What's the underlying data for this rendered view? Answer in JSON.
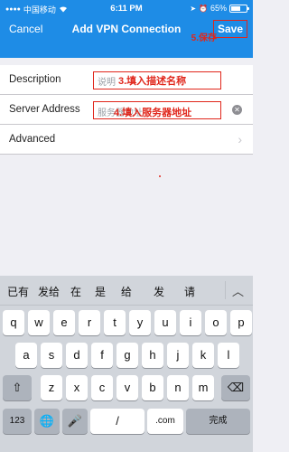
{
  "status": {
    "carrier": "中国移动",
    "time": "6:11 PM",
    "battery": "65%",
    "battery_level": 0.65
  },
  "nav": {
    "cancel": "Cancel",
    "title": "Add VPN Connection",
    "save": "Save",
    "save_annotation": "5.保存"
  },
  "form": {
    "description": {
      "label": "Description",
      "placeholder": "说明",
      "annotation": "3.填入描述名称"
    },
    "server": {
      "label": "Server Address",
      "placeholder": "服务器地址",
      "annotation": "4.填入服务器地址"
    },
    "advanced": {
      "label": "Advanced"
    }
  },
  "keyboard": {
    "candidates": [
      "已有",
      "发给",
      "在",
      "是",
      "给",
      "发",
      "请"
    ],
    "row1": [
      "q",
      "w",
      "e",
      "r",
      "t",
      "y",
      "u",
      "i",
      "o",
      "p"
    ],
    "row2": [
      "a",
      "s",
      "d",
      "f",
      "g",
      "h",
      "j",
      "k",
      "l"
    ],
    "row3": [
      "z",
      "x",
      "c",
      "v",
      "b",
      "n",
      "m"
    ],
    "numbers_key": "123",
    "slash_key": "/",
    "com_key": ".com",
    "done_key": "完成"
  },
  "icons": {
    "collapse": "chevron-up-icon",
    "shift": "shift-icon",
    "delete": "backspace-icon",
    "globe": "globe-icon",
    "mic": "microphone-icon"
  },
  "colors": {
    "accent": "#1e8ce6",
    "annotation": "#e0261b"
  }
}
